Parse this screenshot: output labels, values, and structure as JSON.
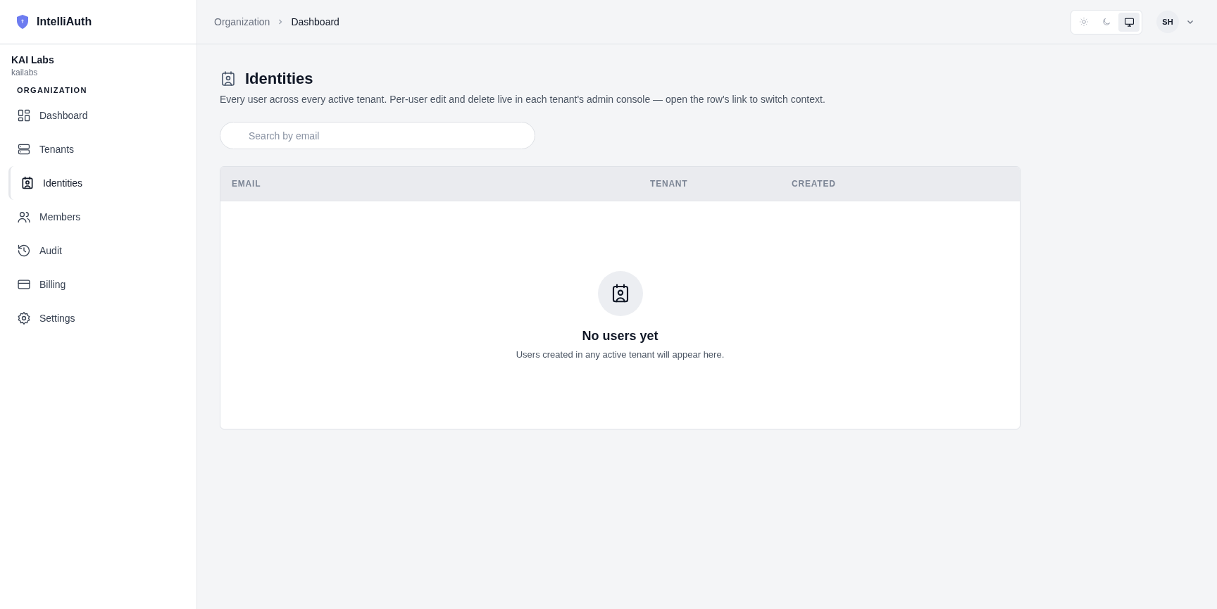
{
  "brand": {
    "name": "IntelliAuth"
  },
  "org": {
    "name": "KAI Labs",
    "slug": "kailabs"
  },
  "sidebar": {
    "section": "ORGANIZATION",
    "items": [
      {
        "label": "Dashboard",
        "kind": "dashboard",
        "selected": false
      },
      {
        "label": "Tenants",
        "kind": "tenants",
        "selected": false
      },
      {
        "label": "Identities",
        "kind": "identities",
        "selected": true
      },
      {
        "label": "Members",
        "kind": "members",
        "selected": false
      },
      {
        "label": "Audit",
        "kind": "audit",
        "selected": false
      },
      {
        "label": "Billing",
        "kind": "billing",
        "selected": false
      },
      {
        "label": "Settings",
        "kind": "settings",
        "selected": false
      }
    ]
  },
  "breadcrumb": [
    "Organization",
    "Dashboard"
  ],
  "theme_toggle": [
    {
      "kind": "light",
      "selected": false
    },
    {
      "kind": "dark",
      "selected": false
    },
    {
      "kind": "system",
      "selected": true
    }
  ],
  "user": {
    "initials": "SH"
  },
  "page": {
    "title": "Identities",
    "description": "Every user across every active tenant. Per-user edit and delete live in each tenant's admin console — open the row's link to switch context."
  },
  "search": {
    "placeholder": "Search by email"
  },
  "table": {
    "columns": [
      "EMAIL",
      "TENANT",
      "CREATED"
    ],
    "empty": {
      "title": "No users yet",
      "text": "Users created in any active tenant will appear here."
    }
  }
}
